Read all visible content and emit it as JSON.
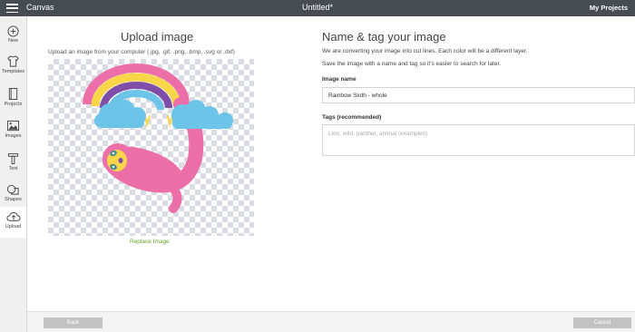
{
  "topbar": {
    "app_title": "Canvas",
    "doc_title": "Untitled*",
    "my_projects": "My Projects"
  },
  "sidebar": {
    "items": [
      {
        "label": "New",
        "icon": "plus-circle-icon"
      },
      {
        "label": "Templates",
        "icon": "shirt-icon"
      },
      {
        "label": "Projects",
        "icon": "book-icon"
      },
      {
        "label": "Images",
        "icon": "image-icon"
      },
      {
        "label": "Text",
        "icon": "text-icon"
      },
      {
        "label": "Shapes",
        "icon": "shapes-icon"
      },
      {
        "label": "Upload",
        "icon": "cloud-upload-icon"
      }
    ],
    "active": "Upload"
  },
  "upload": {
    "title": "Upload image",
    "subtitle": "Upload an image from your computer (.jpg, .gif, .png, .bmp, .svg or .dxf)",
    "replace_label": "Replace Image"
  },
  "form": {
    "title": "Name & tag your image",
    "desc1": "We are converting your image into cut lines. Each color will be a different layer.",
    "desc2": "Save the image with a name and tag so it's easier to search for later.",
    "name_label": "Image name",
    "name_value": "Rainbow Sloth - whole",
    "tags_label": "Tags (recommended)",
    "tags_placeholder": "Lion, wild, panther, animal (examples)"
  },
  "footer": {
    "back_label": "Back",
    "cancel_label": "Cancel"
  },
  "colors": {
    "topbar": "#474c52",
    "accent_link": "#6aa52a",
    "button_disabled": "#c2c2c2",
    "sloth_pink": "#ec6fa8",
    "cloud_blue": "#6cc5e8"
  }
}
